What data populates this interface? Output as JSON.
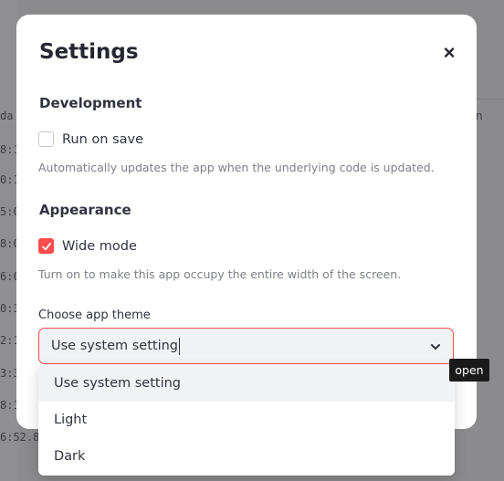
{
  "background": {
    "left_cells": [
      "da",
      "8:1",
      "0:1",
      "5:0",
      "8:0",
      "6:0",
      "0:3",
      "2:1",
      "3:3",
      "8:1",
      "6:52.88"
    ],
    "right_label": "n"
  },
  "modal": {
    "title": "Settings",
    "close_icon": "×",
    "development": {
      "title": "Development",
      "run_on_save_label": "Run on save",
      "run_on_save_checked": false,
      "help": "Automatically updates the app when the underlying code is updated."
    },
    "appearance": {
      "title": "Appearance",
      "wide_mode_label": "Wide mode",
      "wide_mode_checked": true,
      "help": "Turn on to make this app occupy the entire width of the screen."
    },
    "theme": {
      "label": "Choose app theme",
      "selected": "Use system setting",
      "options": [
        "Use system setting",
        "Light",
        "Dark"
      ]
    }
  },
  "tooltip": {
    "text": "open"
  },
  "colors": {
    "accent": "#ff4b4b",
    "option_hover": "#f0f2f6",
    "text": "#31333f",
    "muted": "#7d7f87"
  }
}
